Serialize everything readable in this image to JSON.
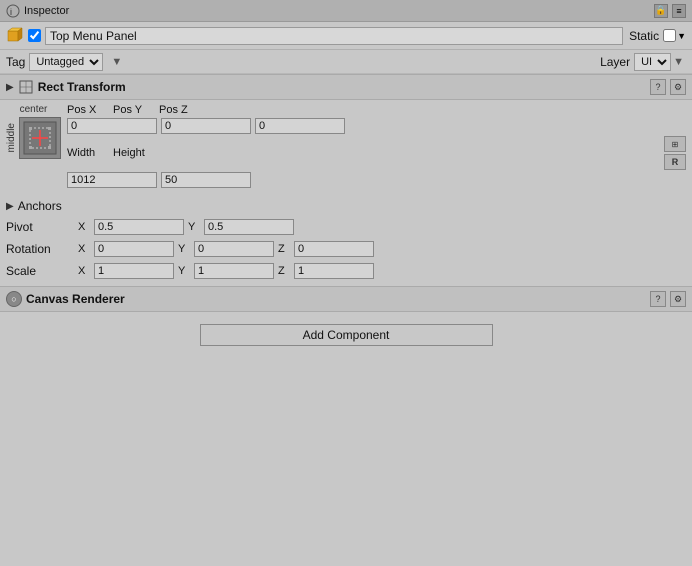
{
  "titleBar": {
    "icon": "inspector-icon",
    "title": "Inspector",
    "lockBtn": "🔒",
    "menuBtn": "≡"
  },
  "objectHeader": {
    "checked": true,
    "name": "Top Menu Panel",
    "staticLabel": "Static",
    "staticChecked": false
  },
  "tagRow": {
    "tagLabel": "Tag",
    "tagValue": "Untagged",
    "layerLabel": "Layer",
    "layerValue": "UI"
  },
  "rectTransform": {
    "title": "Rect Transform",
    "center": "center",
    "middle": "middle",
    "posXLabel": "Pos X",
    "posYLabel": "Pos Y",
    "posZLabel": "Pos Z",
    "posXVal": "0",
    "posYVal": "0",
    "posZVal": "0",
    "widthLabel": "Width",
    "heightLabel": "Height",
    "widthVal": "1012",
    "heightVal": "50",
    "anchorsLabel": "Anchors",
    "pivotLabel": "Pivot",
    "pivotX": "0.5",
    "pivotY": "0.5",
    "rotationLabel": "Rotation",
    "rotationX": "0",
    "rotationY": "0",
    "rotationZ": "0",
    "scaleLabel": "Scale",
    "scaleX": "1",
    "scaleY": "1",
    "scaleZ": "1"
  },
  "canvasRenderer": {
    "title": "Canvas Renderer"
  },
  "addComponent": {
    "label": "Add Component"
  }
}
